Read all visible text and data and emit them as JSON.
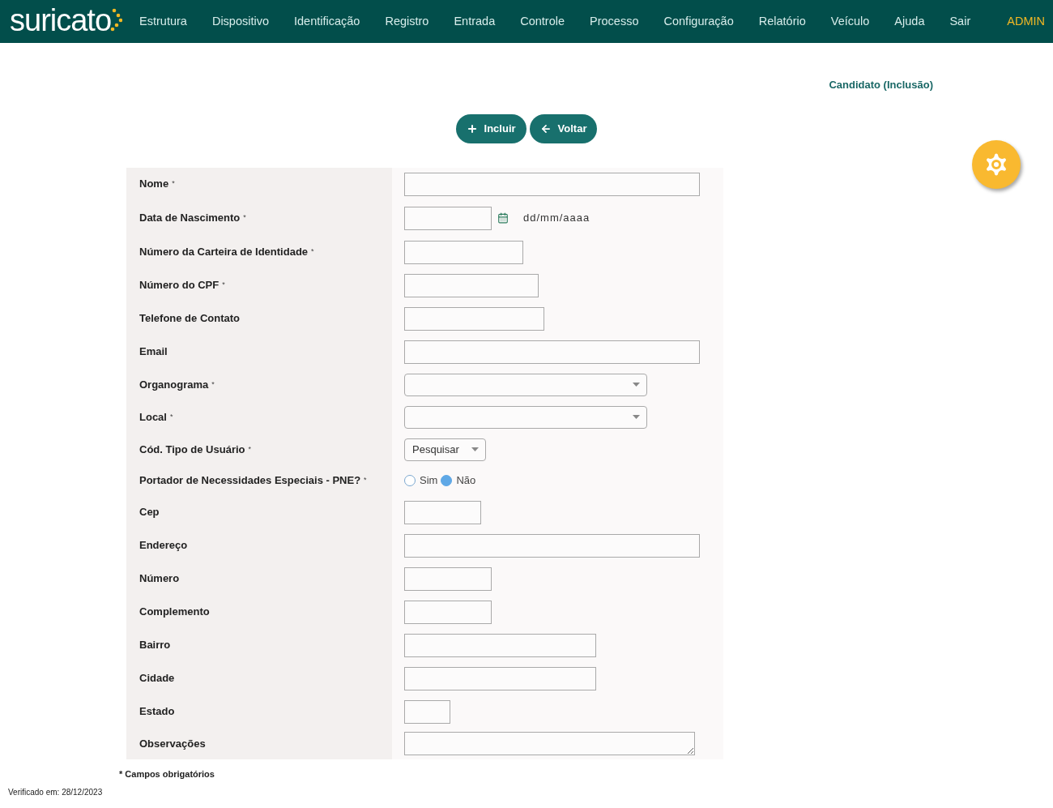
{
  "nav": {
    "logo": "suricato",
    "items": [
      "Estrutura",
      "Dispositivo",
      "Identificação",
      "Registro",
      "Entrada",
      "Controle",
      "Processo",
      "Configuração",
      "Relatório",
      "Veículo",
      "Ajuda",
      "Sair"
    ],
    "user": "ADMIN"
  },
  "page_title": "Candidato (Inclusão)",
  "actions": [
    {
      "label": "Incluir",
      "kind": "add"
    },
    {
      "label": "Voltar",
      "kind": "back"
    }
  ],
  "fields": [
    {
      "label": "Nome",
      "required_mark": "*",
      "kind": "text"
    },
    {
      "label": "Data de Nascimento",
      "required_mark": "*",
      "kind": "date",
      "hint": "dd/mm/aaaa"
    },
    {
      "label": "Número da Carteira de Identidade",
      "required_mark": "*",
      "kind": "text"
    },
    {
      "label": "Número do CPF",
      "required_mark": "*",
      "kind": "text"
    },
    {
      "label": "Telefone de Contato",
      "kind": "text"
    },
    {
      "label": "Email",
      "kind": "text"
    },
    {
      "label": "Organograma",
      "required_mark": "*",
      "kind": "select"
    },
    {
      "label": "Local",
      "required_mark": "*",
      "kind": "select"
    },
    {
      "label": "Cód. Tipo de Usuário",
      "required_mark": "*",
      "kind": "dropdown",
      "value": "Pesquisar"
    },
    {
      "label": "Portador de Necessidades Especiais - PNE?",
      "required_mark": "*",
      "kind": "radio",
      "options": [
        {
          "label": "Sim",
          "selected": false
        },
        {
          "label": "Não",
          "selected": true
        }
      ]
    },
    {
      "label": "Cep",
      "kind": "text"
    },
    {
      "label": "Endereço",
      "kind": "text"
    },
    {
      "label": "Número",
      "kind": "text"
    },
    {
      "label": "Complemento",
      "kind": "text"
    },
    {
      "label": "Bairro",
      "kind": "text"
    },
    {
      "label": "Cidade",
      "kind": "text"
    },
    {
      "label": "Estado",
      "kind": "text"
    },
    {
      "label": "Observações",
      "kind": "textarea"
    }
  ],
  "required_note": "* Campos obrigatórios",
  "footer": "Verificado em: 28/12/2023"
}
